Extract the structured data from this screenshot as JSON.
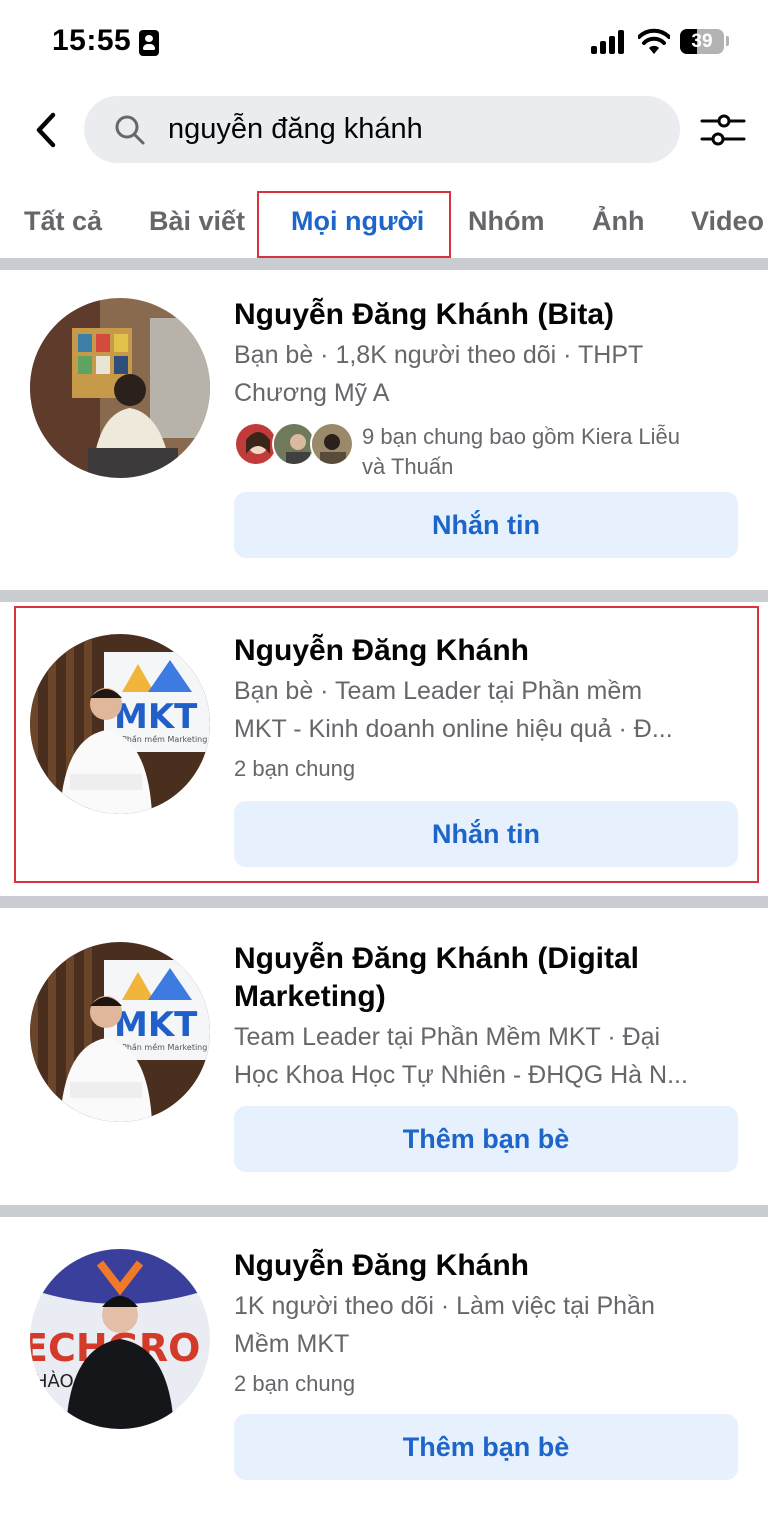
{
  "status_bar": {
    "time": "15:55",
    "battery": "39",
    "battery_level": 0.39
  },
  "search": {
    "query": "nguyễn đăng khánh"
  },
  "tabs": [
    {
      "label": "Tất cả",
      "active": false
    },
    {
      "label": "Bài viết",
      "active": false
    },
    {
      "label": "Mọi người",
      "active": true
    },
    {
      "label": "Nhóm",
      "active": false
    },
    {
      "label": "Ảnh",
      "active": false
    },
    {
      "label": "Video",
      "active": false
    }
  ],
  "results": [
    {
      "name": "Nguyễn Đăng Khánh (Bita)",
      "meta_line1": "Bạn bè · 1,8K người theo dõi · THPT",
      "meta_line2": "Chương Mỹ A",
      "mutual_line1": "9 bạn chung bao gồm Kiera Liễu",
      "mutual_line2": "và Thuấn",
      "action": "Nhắn tin"
    },
    {
      "name": "Nguyễn Đăng Khánh",
      "meta_line1": "Bạn bè · Team Leader tại Phần mềm",
      "meta_line2": "MKT - Kinh doanh online hiệu quả · Đ...",
      "mutual": "2 bạn chung",
      "action": "Nhắn tin",
      "avatar_logo": "MKT",
      "avatar_logo_sub": "Phần mềm Marketing"
    },
    {
      "name_line1": "Nguyễn Đăng Khánh (Digital",
      "name_line2": "Marketing)",
      "meta_line1": "Team Leader tại Phần Mềm MKT · Đại",
      "meta_line2": "Học Khoa Học Tự Nhiên - ĐHQG Hà N...",
      "action": "Thêm bạn bè",
      "avatar_logo": "MKT",
      "avatar_logo_sub": "Phần mềm Marketing"
    },
    {
      "name": "Nguyễn Đăng Khánh",
      "meta_line1": "1K người theo dõi · Làm việc tại Phần",
      "meta_line2": "Mềm MKT",
      "mutual": "2 bạn chung",
      "action": "Thêm bạn bè",
      "avatar_banner": "ECHGRO",
      "avatar_banner_sub": "HÀO      NGH"
    }
  ],
  "colors": {
    "accent": "#1d65c8",
    "highlight": "#d9333f",
    "button_bg": "#e7f0fd",
    "secondary_text": "#65676b"
  }
}
